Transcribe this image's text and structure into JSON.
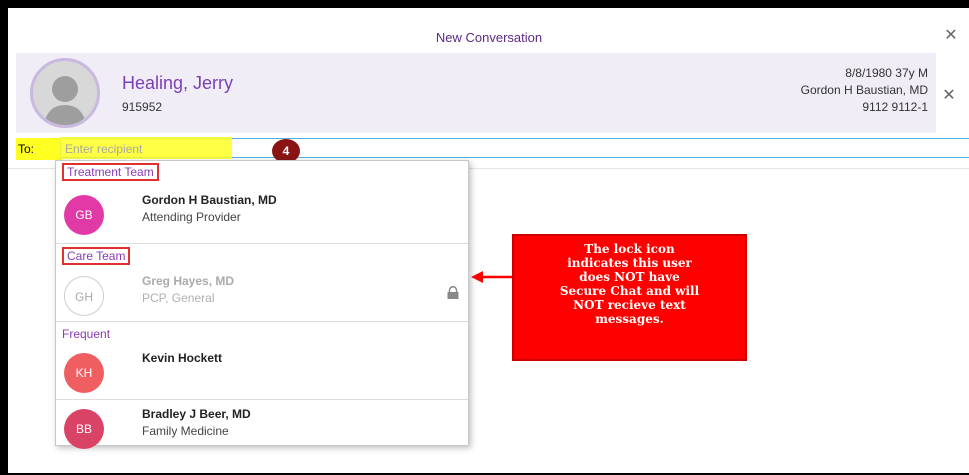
{
  "window": {
    "title": "New Conversation"
  },
  "patient": {
    "name": "Healing, Jerry",
    "mrn": "915952",
    "dob_age_sex": "8/8/1980 37y M",
    "provider": "Gordon H Baustian, MD",
    "id": "9112 9112-1"
  },
  "compose": {
    "to_label": "To:",
    "placeholder": "Enter recipient",
    "step_badge": "4"
  },
  "sections": {
    "treatment_team": "Treatment Team",
    "care_team": "Care Team",
    "frequent": "Frequent"
  },
  "recipients": [
    {
      "initials": "GB",
      "name": "Gordon H Baustian, MD",
      "role": "Attending Provider",
      "color": "#e13aa7"
    },
    {
      "initials": "GH",
      "name": "Greg Hayes, MD",
      "role": "PCP, General",
      "color": "#ffffff"
    },
    {
      "initials": "KH",
      "name": "Kevin Hockett",
      "role": "",
      "color": "#ef5f62"
    },
    {
      "initials": "BB",
      "name": "Bradley J Beer, MD",
      "role": "Family Medicine",
      "color": "#d94466"
    }
  ],
  "callout": {
    "lines": [
      "The lock icon",
      "indicates this user",
      "does NOT have",
      "Secure Chat and will",
      "NOT recieve text",
      "messages."
    ]
  },
  "icons": {
    "close": "close-icon",
    "lock": "lock-icon",
    "avatar": "person-silhouette-icon"
  },
  "colors": {
    "accent": "#7a3fb5",
    "callout": "#ff0000",
    "highlight": "#ffff22"
  }
}
